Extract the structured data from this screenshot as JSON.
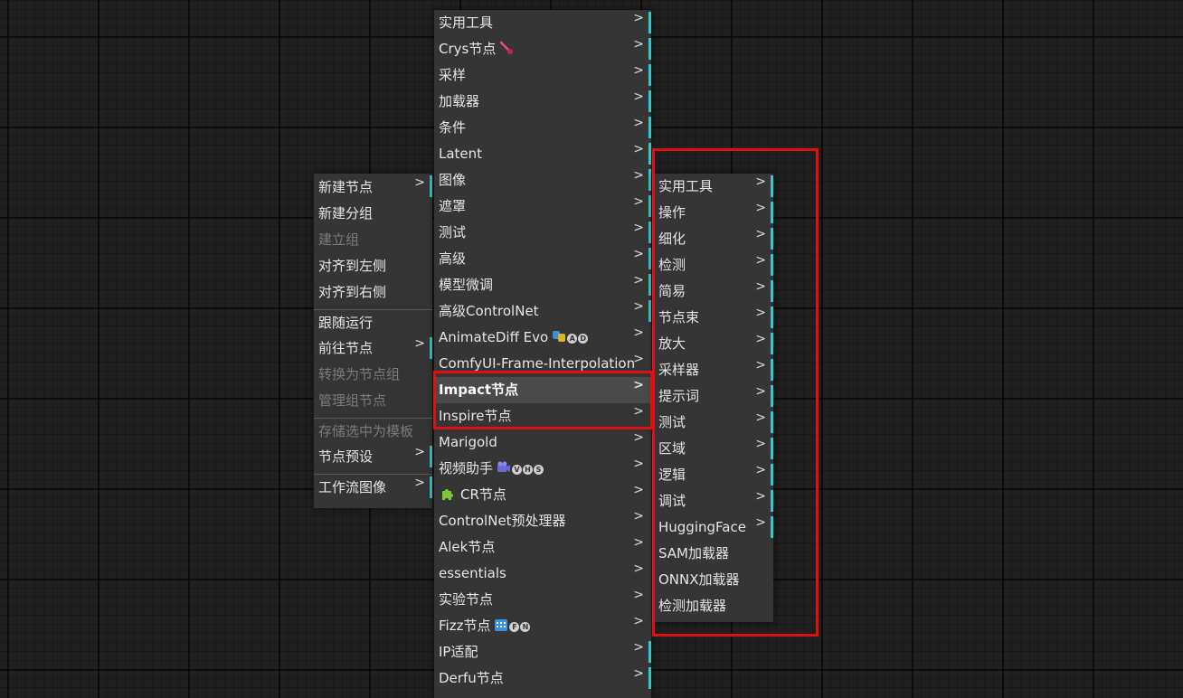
{
  "left_menu": {
    "items": [
      {
        "label": "新建节点",
        "submenu": true
      },
      {
        "label": "新建分组"
      },
      {
        "label": "建立组",
        "disabled": true
      },
      {
        "label": "对齐到左侧"
      },
      {
        "label": "对齐到右侧"
      },
      {
        "label": "跟随运行"
      },
      {
        "label": "前往节点",
        "submenu": true
      },
      {
        "label": "转换为节点组",
        "disabled": true
      },
      {
        "label": "管理组节点",
        "disabled": true
      },
      {
        "label": "存储选中为模板",
        "disabled": true
      },
      {
        "label": "节点预设",
        "submenu": true
      },
      {
        "label": "工作流图像",
        "submenu": true
      }
    ]
  },
  "middle_menu": {
    "items": [
      {
        "label": "实用工具"
      },
      {
        "label": "Crys节点"
      },
      {
        "label": "采样"
      },
      {
        "label": "加载器"
      },
      {
        "label": "条件"
      },
      {
        "label": "Latent"
      },
      {
        "label": "图像"
      },
      {
        "label": "遮罩"
      },
      {
        "label": "测试"
      },
      {
        "label": "高级"
      },
      {
        "label": "模型微调"
      },
      {
        "label": "高级ControlNet"
      },
      {
        "label": "AnimateDiff Evo"
      },
      {
        "label": "ComfyUI-Frame-Interpolation"
      },
      {
        "label": "Impact节点"
      },
      {
        "label": "Inspire节点"
      },
      {
        "label": "Marigold"
      },
      {
        "label": "视频助手"
      },
      {
        "label": "CR节点"
      },
      {
        "label": "ControlNet预处理器"
      },
      {
        "label": "Alek节点"
      },
      {
        "label": "essentials"
      },
      {
        "label": "实验节点"
      },
      {
        "label": "Fizz节点"
      },
      {
        "label": "IP适配"
      },
      {
        "label": "Derfu节点"
      }
    ],
    "badges": {
      "animatediff": [
        "A",
        "D"
      ],
      "video": [
        "V",
        "H",
        "S"
      ],
      "fizz": [
        "F",
        "N"
      ]
    }
  },
  "right_menu": {
    "items": [
      {
        "label": "实用工具"
      },
      {
        "label": "操作"
      },
      {
        "label": "细化"
      },
      {
        "label": "检测"
      },
      {
        "label": "简易"
      },
      {
        "label": "节点束"
      },
      {
        "label": "放大"
      },
      {
        "label": "采样器"
      },
      {
        "label": "提示词"
      },
      {
        "label": "测试"
      },
      {
        "label": "区域"
      },
      {
        "label": "逻辑"
      },
      {
        "label": "调试"
      },
      {
        "label": "HuggingFace"
      },
      {
        "label": "SAM加载器"
      },
      {
        "label": "ONNX加载器"
      },
      {
        "label": "检测加载器"
      }
    ]
  },
  "arrow_glyph": ">",
  "colors": {
    "menu_bg": "#353535",
    "accent_bar": "#39c6c6",
    "highlight_box": "#e01010"
  }
}
